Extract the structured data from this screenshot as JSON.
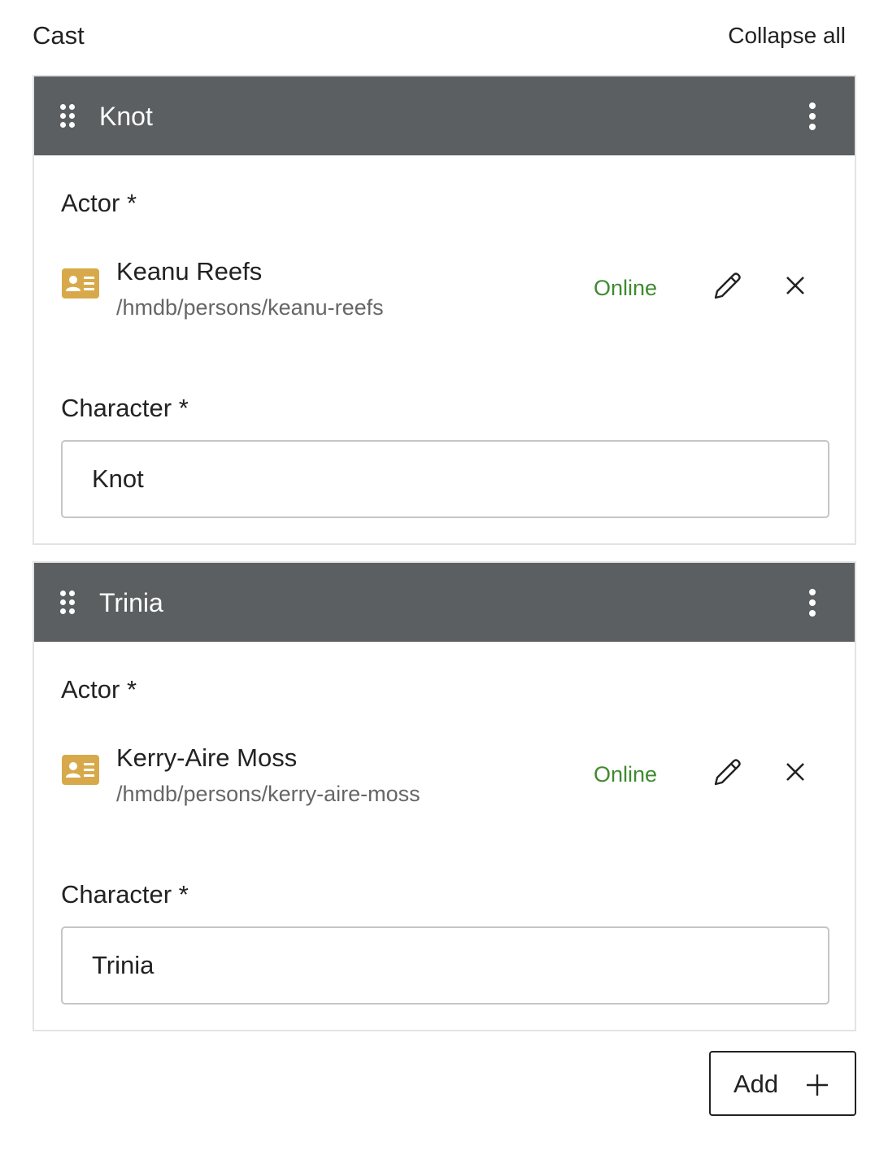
{
  "header": {
    "title": "Cast",
    "collapse_label": "Collapse all"
  },
  "cards": [
    {
      "title": "Knot",
      "actor_label": "Actor *",
      "person_name": "Keanu Reefs",
      "person_path": "/hmdb/persons/keanu-reefs",
      "status": "Online",
      "character_label": "Character *",
      "character_value": "Knot"
    },
    {
      "title": "Trinia",
      "actor_label": "Actor *",
      "person_name": "Kerry-Aire Moss",
      "person_path": "/hmdb/persons/kerry-aire-moss",
      "status": "Online",
      "character_label": "Character *",
      "character_value": "Trinia"
    }
  ],
  "add_button": {
    "label": "Add"
  },
  "colors": {
    "header_bg": "#5b5f61",
    "status_green": "#3f8a2f",
    "contact_icon": "#d8a94a"
  },
  "icons": [
    "drag-handle-icon",
    "more-options-icon",
    "contact-card-icon",
    "pencil-icon",
    "close-icon",
    "plus-icon"
  ]
}
